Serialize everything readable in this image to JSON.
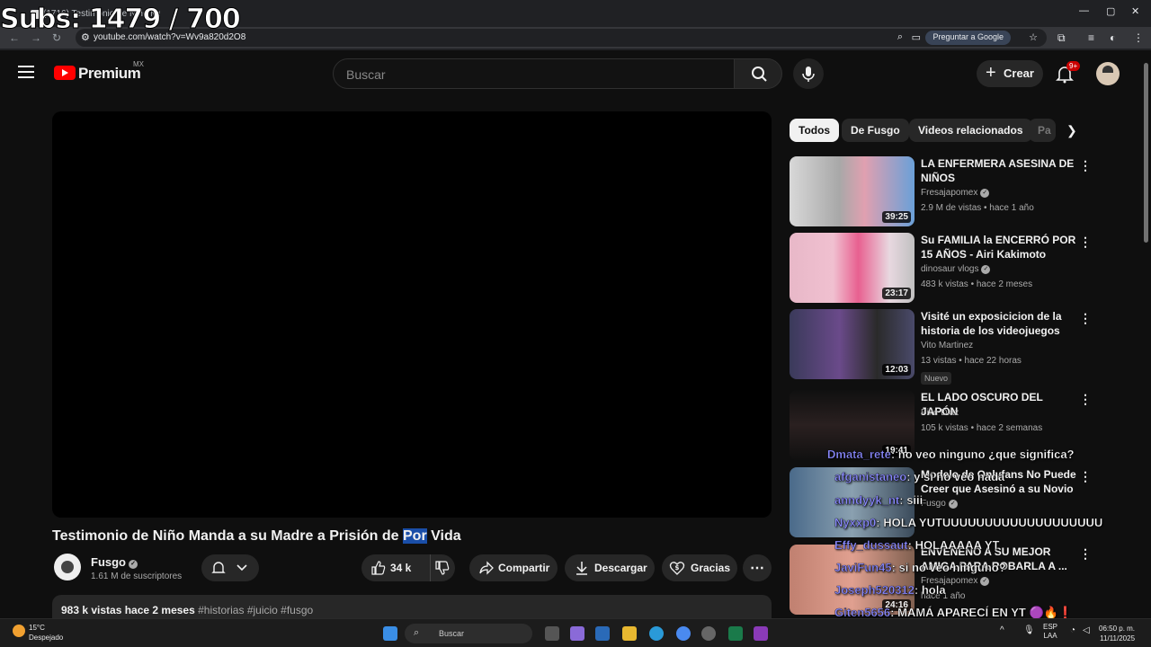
{
  "browser": {
    "tab_title": "(1716) Testimonio de Niño Ma...",
    "url": "youtube.com/watch?v=Wv9a820d2O8",
    "ask_google": "Preguntar a Google",
    "window_controls": [
      "—",
      "▢",
      "✕"
    ]
  },
  "overlay": {
    "subs": "Subs: 1479 / 700"
  },
  "yt_header": {
    "logo_text": "Premium",
    "region": "MX",
    "search_placeholder": "Buscar",
    "create_label": "Crear",
    "notif_badge": "9+"
  },
  "video": {
    "title_part1": "Testimonio de Niño Manda a su Madre a Prisión de ",
    "title_highlight": "Por",
    "title_part2": " Vida",
    "channel_name": "Fusgo",
    "subscribers": "1.61 M de suscriptores",
    "likes": "34 k",
    "share_label": "Compartir",
    "download_label": "Descargar",
    "thanks_label": "Gracias",
    "views_date": "983 k vistas  hace 2 meses",
    "tags": "#historias #juicio #fusgo"
  },
  "chips": [
    "Todos",
    "De Fusgo",
    "Videos relacionados",
    "Pa"
  ],
  "recommendations": [
    {
      "title": "LA ENFERMERA ASESINA DE NIÑOS",
      "channel": "Fresajapomex",
      "meta": "2.9 M de vistas • hace 1 año",
      "duration": "39:25",
      "verified": true,
      "new": ""
    },
    {
      "title": "Su FAMILIA la ENCERRÓ POR 15 AÑOS - Airi Kakimoto",
      "channel": "dinosaur vlogs",
      "meta": "483 k vistas • hace 2 meses",
      "duration": "23:17",
      "verified": true,
      "new": ""
    },
    {
      "title": "Visité un exposicicion de la historia de los videojuegos",
      "channel": "Vito Martinez",
      "meta": "13 vistas • hace 22 horas",
      "duration": "12:03",
      "verified": false,
      "new": "Nuevo"
    },
    {
      "title": "EL LADO OSCURO DEL JAPÓN",
      "channel": "Pike Diaz",
      "meta": "105 k vistas • hace 2 semanas",
      "duration": "19:41",
      "verified": false,
      "new": ""
    },
    {
      "title": "Modelo de Onlyfans No Puede Creer que Asesinó a su Novio",
      "channel": "Fusgo",
      "meta": "",
      "duration": "",
      "verified": true,
      "new": ""
    },
    {
      "title": "ENVENENÓ A SU MEJOR AMIGA PARA ROBARLA A ...",
      "channel": "Fresajapomex",
      "meta": "hace 1 año",
      "duration": "24:16",
      "verified": true,
      "new": ""
    }
  ],
  "chat": [
    {
      "user": "Dmata_rete",
      "msg": ": no veo ninguno ¿que significa?"
    },
    {
      "user": "afganistaneo",
      "msg": ": y si no veo nada"
    },
    {
      "user": "anndyyk_nt",
      "msg": ": siii"
    },
    {
      "user": "Nyxxp0",
      "msg": ": HOLA YUTUUUUUUUUUUUUUUUUUUU"
    },
    {
      "user": "Effy_dussaut",
      "msg": ": HOLAAAAA YT"
    },
    {
      "user": "JaviFun45",
      "msg": ": si no veo ninguno?"
    },
    {
      "user": "Joseph520312",
      "msg": ": hola"
    },
    {
      "user": "Giten5656",
      "msg": ": MAMÁ APARECÍ EN YT 🟣🔥❗"
    }
  ],
  "taskbar": {
    "weather_temp": "15°C",
    "weather_desc": "Despejado",
    "search_label": "Buscar",
    "lang": "ESP",
    "lang2": "LAA",
    "time": "06:50 p. m.",
    "date": "11/11/2025"
  },
  "colors": {
    "accent_red": "#ff0000",
    "bg": "#0f0f0f",
    "chip_active": "#f1f1f1",
    "chat_user": "#8a8aff"
  }
}
